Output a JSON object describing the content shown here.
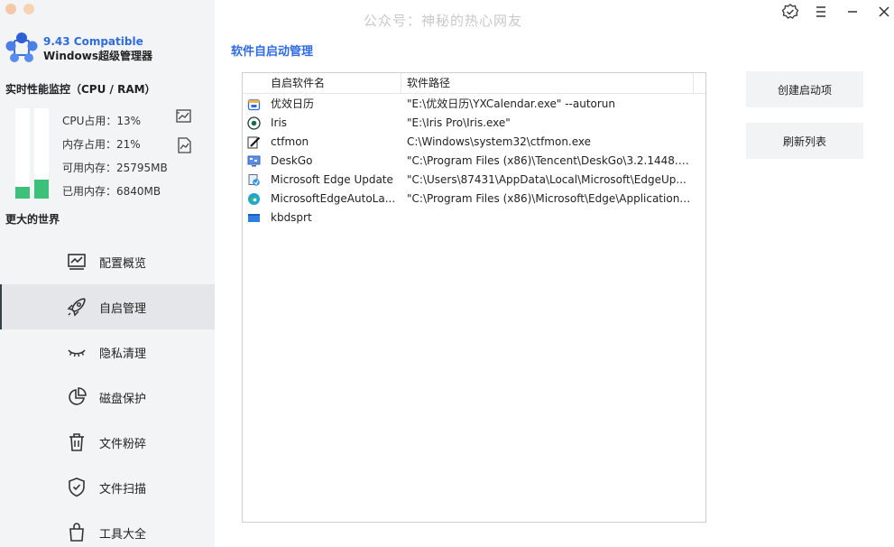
{
  "watermark": "公众号：神秘的热心网友",
  "brand": {
    "version": "9.43 Compatible",
    "name": "Windows超级管理器"
  },
  "monitor": {
    "title": "实时性能监控（CPU / RAM）",
    "cpu_label": "CPU占用：13%",
    "mem_label": "内存占用：21%",
    "avail_label": "可用内存：25795MB",
    "used_label": "已用内存：6840MB",
    "cpu_percent": 13,
    "mem_percent": 21
  },
  "tagline": "更大的世界",
  "nav": [
    {
      "label": "配置概览",
      "icon": "chart-icon"
    },
    {
      "label": "自启管理",
      "icon": "rocket-icon",
      "active": true
    },
    {
      "label": "隐私清理",
      "icon": "eye-closed-icon"
    },
    {
      "label": "磁盘保护",
      "icon": "pie-chart-icon"
    },
    {
      "label": "文件粉碎",
      "icon": "trash-icon"
    },
    {
      "label": "文件扫描",
      "icon": "shield-check-icon"
    },
    {
      "label": "工具大全",
      "icon": "bag-icon"
    }
  ],
  "main": {
    "title": "软件自启动管理",
    "columns": [
      "自启软件名",
      "软件路径"
    ],
    "rows": [
      {
        "name": "优效日历",
        "path": "\"E:\\优效日历\\YXCalendar.exe\" --autorun",
        "icon": "calendar-icon"
      },
      {
        "name": "Iris",
        "path": "\"E:\\Iris Pro\\Iris.exe\"",
        "icon": "eye-icon"
      },
      {
        "name": "ctfmon",
        "path": "C:\\Windows\\system32\\ctfmon.exe",
        "icon": "pen-icon"
      },
      {
        "name": "DeskGo",
        "path": "\"C:\\Program Files (x86)\\Tencent\\DeskGo\\3.2.1448.12...",
        "icon": "desktop-icon"
      },
      {
        "name": "Microsoft Edge Update",
        "path": "\"C:\\Users\\87431\\AppData\\Local\\Microsoft\\EdgeUp...",
        "icon": "installer-icon"
      },
      {
        "name": "MicrosoftEdgeAutoLa...",
        "path": "\"C:\\Program Files (x86)\\Microsoft\\Edge\\Application\\...",
        "icon": "edge-icon"
      },
      {
        "name": "kbdsprt",
        "path": "",
        "icon": "window-icon"
      }
    ],
    "buttons": {
      "create": "创建启动项",
      "refresh": "刷新列表"
    }
  },
  "colors": {
    "accent": "#2f6be0",
    "meter": "#3cc17a",
    "sidebar_bg": "#f3f4f6"
  }
}
